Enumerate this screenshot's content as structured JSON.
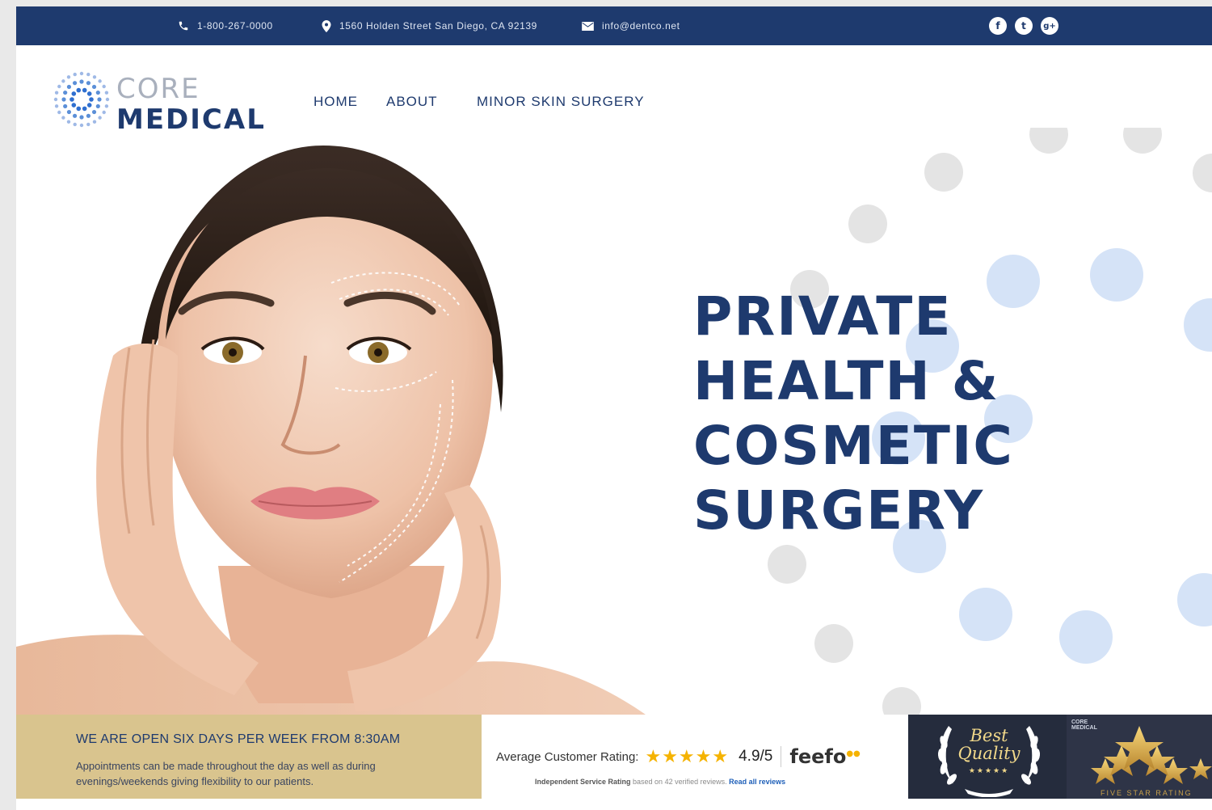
{
  "topbar": {
    "phone": "1-800-267-0000",
    "address": "1560 Holden Street San Diego, CA 92139",
    "email": "info@dentco.net",
    "icons": [
      "phone-icon",
      "map-pin-icon",
      "envelope-icon"
    ],
    "socials": [
      {
        "icon": "facebook-icon",
        "glyph": "f"
      },
      {
        "icon": "twitter-icon",
        "glyph": "t"
      },
      {
        "icon": "google-plus-icon",
        "glyph": "g+"
      }
    ]
  },
  "logo": {
    "word1": "CORE",
    "word2": "MEDICAL"
  },
  "nav": {
    "items": [
      "HOME",
      "ABOUT",
      "MINOR SKIN SURGERY"
    ]
  },
  "hero": {
    "headline": [
      "PRIVATE",
      "HEALTH &",
      "COSMETIC",
      "SURGERY"
    ]
  },
  "hours": {
    "heading": "WE ARE OPEN SIX DAYS PER WEEK FROM 8:30AM",
    "text": "Appointments can be made throughout the day as well as during evenings/weekends giving flexibility to our patients."
  },
  "rating": {
    "label": "Average Customer Rating:",
    "stars": "★★★★★",
    "score": "4.9/5",
    "brand": "feefo",
    "sub_bold": "Independent Service Rating",
    "sub_text": " based on 42 verified reviews. ",
    "sub_link": "Read all reviews"
  },
  "badges": {
    "best1": "Best",
    "best2": "Quality",
    "best_stars": "★★★★★",
    "mini_logo1": "CORE",
    "mini_logo2": "MEDICAL",
    "five_star": "FIVE STAR RATING"
  },
  "colors": {
    "brand_navy": "#1e3a6e",
    "gold": "#d9c48e",
    "star": "#f5b301",
    "dot_blue": "#d5e3f7",
    "dot_gray": "#e4e4e4"
  }
}
